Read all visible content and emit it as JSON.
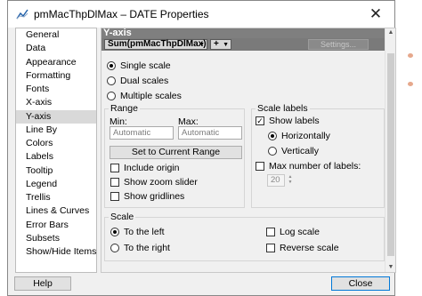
{
  "window": {
    "title": "pmMacThpDlMax – DATE Properties",
    "close_glyph": "✕"
  },
  "nav": {
    "items": [
      "General",
      "Data",
      "Appearance",
      "Formatting",
      "Fonts",
      "X-axis",
      "Y-axis",
      "Line By",
      "Colors",
      "Labels",
      "Tooltip",
      "Legend",
      "Trellis",
      "Lines & Curves",
      "Error Bars",
      "Subsets",
      "Show/Hide Items"
    ],
    "selected_index": 6
  },
  "section": {
    "title": "Y-axis",
    "column_select": "Sum(pmMacThpDlMax)",
    "add_select": "+",
    "settings_button": "Settings..."
  },
  "scale_mode": {
    "options": [
      "Single scale",
      "Dual scales",
      "Multiple scales"
    ],
    "selected": "Single scale"
  },
  "range": {
    "legend": "Range",
    "min_label": "Min:",
    "max_label": "Max:",
    "min_placeholder": "Automatic",
    "max_placeholder": "Automatic",
    "set_button": "Set to Current Range",
    "include_origin": "Include origin",
    "show_zoom_slider": "Show zoom slider",
    "show_gridlines": "Show gridlines",
    "include_origin_checked": false,
    "show_zoom_slider_checked": false,
    "show_gridlines_checked": false
  },
  "scale_labels": {
    "legend": "Scale labels",
    "show_labels": "Show labels",
    "show_labels_checked": true,
    "horizontally": "Horizontally",
    "vertically": "Vertically",
    "orientation": "Horizontally",
    "max_number": "Max number of labels:",
    "max_number_checked": false,
    "max_value": "20"
  },
  "scale": {
    "legend": "Scale",
    "to_left": "To the left",
    "to_right": "To the right",
    "side": "To the left",
    "log_scale": "Log scale",
    "reverse_scale": "Reverse scale",
    "log_scale_checked": false,
    "reverse_scale_checked": false
  },
  "footer": {
    "help": "Help",
    "close": "Close"
  },
  "colors": {
    "accent": "#0078d7",
    "header_bg": "#7f7f7f"
  }
}
